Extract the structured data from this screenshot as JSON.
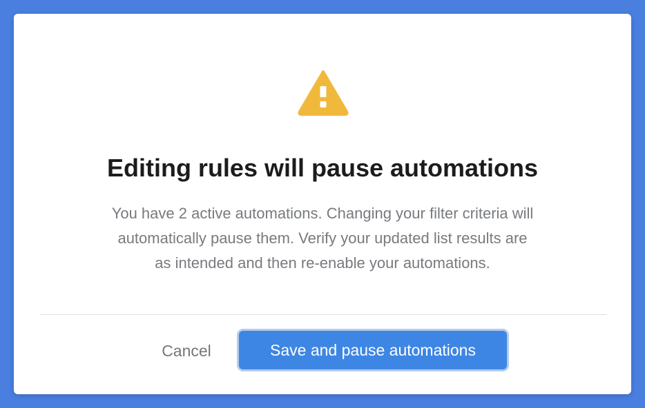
{
  "dialog": {
    "icon": "warning-triangle-icon",
    "icon_color": "#f0b93b",
    "title": "Editing rules will pause automations",
    "body_line_1": "You have 2 active automations. Changing your filter criteria will",
    "body_line_2": "automatically pause them. Verify your updated list results are",
    "body_line_3": "as intended and then re-enable your automations.",
    "cancel_label": "Cancel",
    "confirm_label": "Save and pause automations"
  },
  "colors": {
    "backdrop": "#4a7fe0",
    "primary_button": "#3e86e4",
    "title_text": "#1c1c1c",
    "body_text": "#777a7e"
  }
}
